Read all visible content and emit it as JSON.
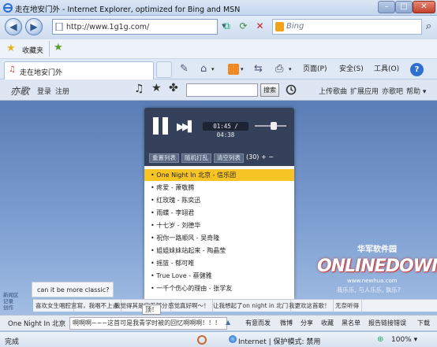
{
  "window": {
    "title": "走在地安门外 - Internet Explorer, optimized for Bing and MSN",
    "minimize": "–",
    "maximize": "□",
    "close": "✕"
  },
  "nav": {
    "back_icon": "◀",
    "forward_icon": "▶",
    "url": "http://www.1g1g.com/",
    "search_engine": "Bing",
    "search_icon": "⌕"
  },
  "favorites": {
    "label": "收藏夹"
  },
  "tab": {
    "title": "走在地安门外"
  },
  "commands": {
    "page": "页面(P)",
    "safety": "安全(S)",
    "tools": "工具(O)",
    "help": "?"
  },
  "site": {
    "logo": "亦歌",
    "login": "登录",
    "register": "注册",
    "search_button": "搜索",
    "right_links": [
      "上传歌曲",
      "扩展应用",
      "亦歌吧",
      "帮助"
    ]
  },
  "player": {
    "time": "01:45 / 04:38",
    "buttons": [
      "重置列表",
      "随机打乱",
      "清空列表"
    ],
    "count": "(30)",
    "add": "+",
    "remove": "−",
    "songs": [
      "One Night In 北京 - 信乐团",
      "疼爱 - 萧敬腾",
      "红玫瑰 - 陈奕迅",
      "雨蝶 - 李翊君",
      "十七岁 - 刘德华",
      "祝你一路顺风 - 吴奇隆",
      "姐姐妹妹站起来 - 陶晶莹",
      "摇篮 - 郁可唯",
      "True Love - 蔡健雅",
      "一千个伤心的理由 - 张学友"
    ],
    "active_index": 0
  },
  "ad": {
    "logo": "ONLINEDOWN",
    "sub": "华军软件园",
    "www": "www.newhua.com",
    "slogan": "我乐乐, 与人乐乐, 孰乐?"
  },
  "left_note": [
    "新闻区",
    "记录",
    "创作"
  ],
  "bubble": "can it be more classic?",
  "suggestions": [
    "喜欢女生唱腔",
    "宫寫，我唱不上去",
    "我觉得其是完美部分",
    "感觉真好啊～！",
    "让我想起了on night in 北门",
    "我更欢这首歌！",
    "无奈听得"
  ],
  "bottom": {
    "now_playing": "One Night In 北京",
    "chat": "啊啊啊~~~这首可是我青学时被的回忆啊啊啊！！！",
    "actions": [
      "有意而发",
      "微博",
      "分享",
      "收藏",
      "黑名单",
      "报告链接错误",
      "下载"
    ],
    "top_tip": "顶！"
  },
  "status": {
    "done": "完成",
    "zone": "Internet | 保护模式: 禁用",
    "zoom": "100%"
  }
}
